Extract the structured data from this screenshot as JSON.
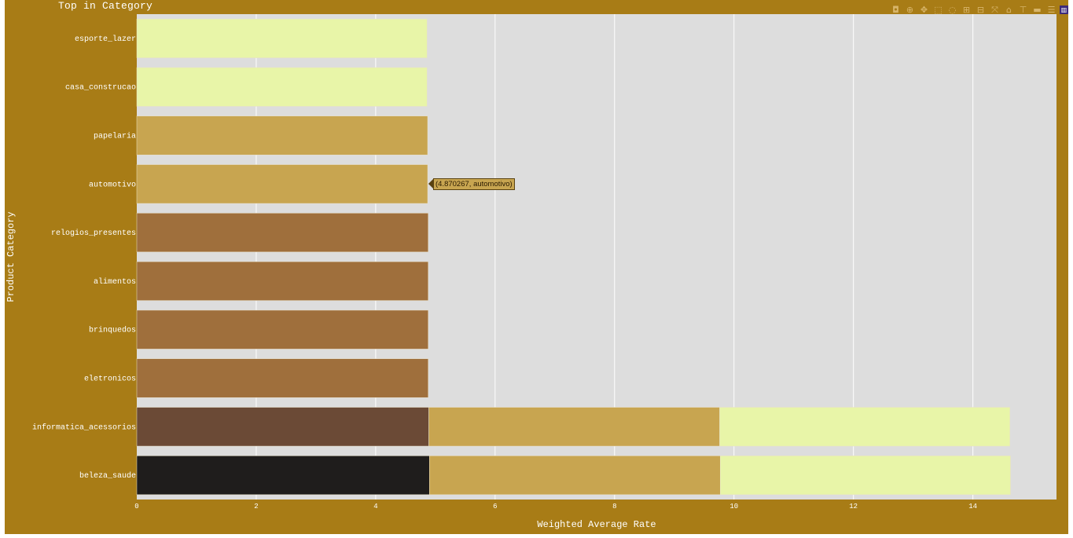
{
  "title": "Top in Category",
  "hover_text": "(4.870267, automotivo)",
  "modebar": {
    "icons": [
      "camera-icon",
      "zoom-icon",
      "pan-icon",
      "box-select-icon",
      "lasso-select-icon",
      "zoom-in-icon",
      "zoom-out-icon",
      "autoscale-icon",
      "reset-axes-icon",
      "spike-lines-icon",
      "hover-closest-icon",
      "hover-compare-icon",
      "plotly-logo-icon"
    ],
    "glyphs": [
      "◘",
      "⊕",
      "✥",
      "⬚",
      "◌",
      "⊞",
      "⊟",
      "⤧",
      "⌂",
      "⊤",
      "▬",
      "☰",
      "▥"
    ]
  },
  "colors": {
    "background": "#a87c16",
    "plot_bg": "#dddddd",
    "grid": "#ffffff",
    "palette": [
      "#1f1d1c",
      "#6b4a36",
      "#9f6f3c",
      "#c8a550",
      "#e8f5a8"
    ]
  },
  "chart_data": {
    "type": "bar",
    "orientation": "horizontal",
    "stacked": true,
    "title": "Top in Category",
    "xlabel": "Weighted Average Rate",
    "ylabel": "Product Category",
    "xlim": [
      0,
      15.4
    ],
    "xticks": [
      0,
      2,
      4,
      6,
      8,
      10,
      12,
      14
    ],
    "grid": true,
    "legend": "none",
    "categories": [
      "esporte_lazer",
      "casa_construcao",
      "papelaria",
      "automotivo",
      "relogios_presentes",
      "alimentos",
      "brinquedos",
      "eletronicos",
      "informatica_acessorios",
      "beleza_saude"
    ],
    "segments": [
      [
        {
          "value": 4.86,
          "color": "#e8f5a8"
        }
      ],
      [
        {
          "value": 4.86,
          "color": "#e8f5a8"
        }
      ],
      [
        {
          "value": 4.87,
          "color": "#c8a550"
        }
      ],
      [
        {
          "value": 4.870267,
          "color": "#c8a550"
        }
      ],
      [
        {
          "value": 4.88,
          "color": "#9f6f3c"
        }
      ],
      [
        {
          "value": 4.88,
          "color": "#9f6f3c"
        }
      ],
      [
        {
          "value": 4.88,
          "color": "#9f6f3c"
        }
      ],
      [
        {
          "value": 4.88,
          "color": "#9f6f3c"
        }
      ],
      [
        {
          "value": 4.89,
          "color": "#6b4a36"
        },
        {
          "value": 4.87,
          "color": "#c8a550"
        },
        {
          "value": 4.86,
          "color": "#e8f5a8"
        }
      ],
      [
        {
          "value": 4.9,
          "color": "#1f1d1c"
        },
        {
          "value": 4.87,
          "color": "#c8a550"
        },
        {
          "value": 4.86,
          "color": "#e8f5a8"
        }
      ]
    ]
  }
}
